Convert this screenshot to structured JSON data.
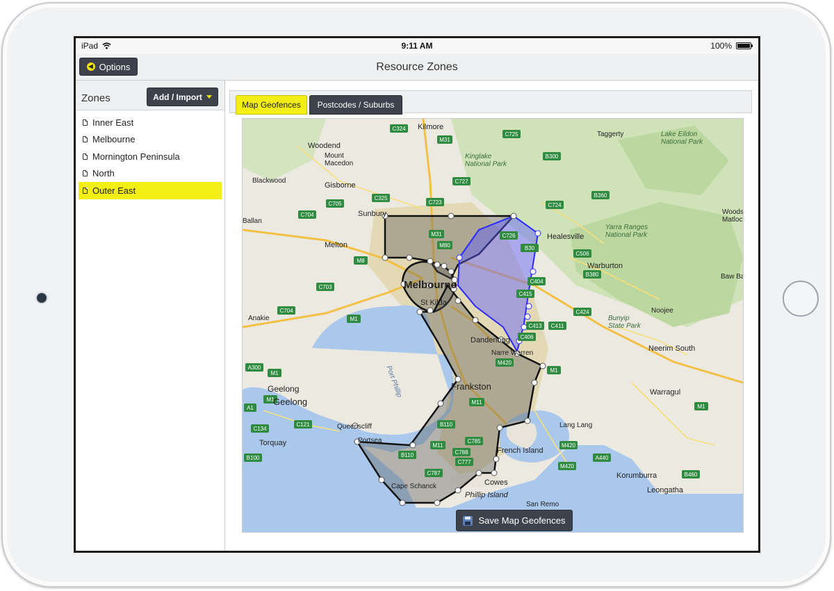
{
  "status_bar": {
    "device": "iPad",
    "time": "9:11 AM",
    "battery": "100%"
  },
  "nav": {
    "back_label": "Options",
    "title": "Resource Zones"
  },
  "sidebar": {
    "header": "Zones",
    "add_button": "Add / Import",
    "items": [
      {
        "label": "Inner East",
        "selected": false
      },
      {
        "label": "Melbourne",
        "selected": false
      },
      {
        "label": "Mornington Peninsula",
        "selected": false
      },
      {
        "label": "North",
        "selected": false
      },
      {
        "label": "Outer East",
        "selected": true
      }
    ]
  },
  "tabs": [
    {
      "label": "Map Geofences",
      "active": true
    },
    {
      "label": "Postcodes / Suburbs",
      "active": false
    }
  ],
  "map": {
    "save_button": "Save Map Geofences",
    "places": {
      "kilmore": "Kilmore",
      "woodend": "Woodend",
      "mount_macedon": "Mount\nMacedon",
      "gisborne": "Gisborne",
      "blackwood": "Blackwood",
      "sunbury": "Sunbury",
      "ballan": "Ballan",
      "melton": "Melton",
      "melbourne": "Melbourne",
      "st_kilda": "St Kilda",
      "anakie": "Anakie",
      "geelong": "Geelong",
      "queenscliff": "Queenscliff",
      "portsea": "Portsea",
      "torquay": "Torquay",
      "frankston": "Frankston",
      "dandenong": "Dandenong",
      "narre_warren": "Narre Warren",
      "healesville": "Healesville",
      "warburton": "Warburton",
      "noojee": "Noojee",
      "neerim_south": "Neerim South",
      "warragul": "Warragul",
      "lang_lang": "Lang Lang",
      "french_island": "French Island",
      "cowes": "Cowes",
      "phillip_island": "Phillip Island",
      "san_remo": "San Remo",
      "cape_schanck": "Cape Schanck",
      "korumburra": "Korumburra",
      "leongatha": "Leongatha",
      "taggerty": "Taggerty",
      "baw_baw": "Baw Baw",
      "woods_matlock": "Woods\nMatloc",
      "kinglake_np": "Kinglake\nNational Park",
      "lake_eildon_np": "Lake Eildon\nNational Park",
      "yarra_ranges_np": "Yarra Ranges\nNational Park",
      "bunyip_sp": "Bunyip\nState Park",
      "port_phillip": "Port Phillip"
    },
    "roads": [
      "C324",
      "M31",
      "C725",
      "B300",
      "C727",
      "C325",
      "C723",
      "C705",
      "C704",
      "C724",
      "B360",
      "M31",
      "M80",
      "C726",
      "B380",
      "M8",
      "C506",
      "C703",
      "C704",
      "M1",
      "C404",
      "C415",
      "C424",
      "C411",
      "C406",
      "C413",
      "M420",
      "M1",
      "A300",
      "M1",
      "M1",
      "B110",
      "C785",
      "C788",
      "C777",
      "C787",
      "M420",
      "A440",
      "B460",
      "C121",
      "C134",
      "B100",
      "A1",
      "M11",
      "M1"
    ]
  },
  "colors": {
    "accent": "#f3ee14",
    "button": "#3d424c",
    "selected_fence": "#5b5bff"
  }
}
